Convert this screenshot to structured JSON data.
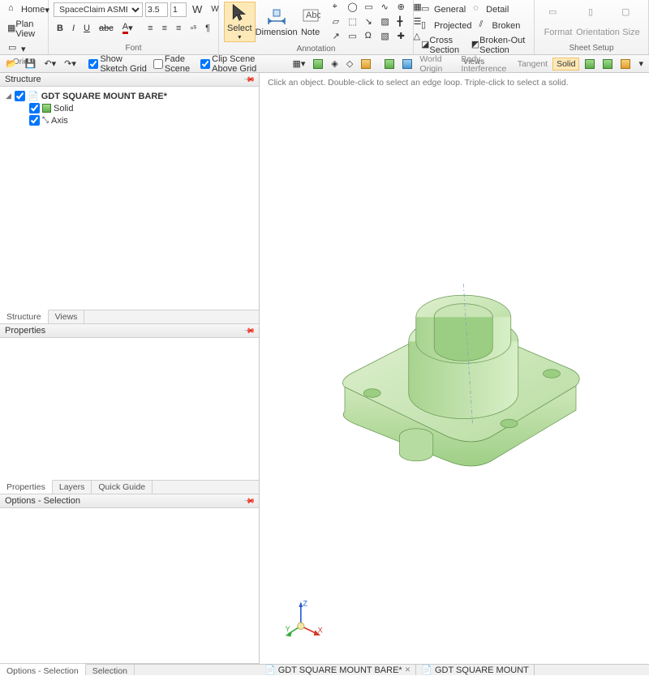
{
  "ribbon": {
    "orient": {
      "home": "Home",
      "planview": "Plan View",
      "label": "Orient"
    },
    "font": {
      "family_value": "SpaceClaim ASME C",
      "size_value": "3.5",
      "weight_value": "1",
      "label": "Font"
    },
    "annotation": {
      "select": "Select",
      "dimension": "Dimension",
      "note": "Note",
      "label": "Annotation"
    },
    "views": {
      "general": "General",
      "projected": "Projected",
      "cross_section": "Cross Section",
      "detail": "Detail",
      "broken": "Broken",
      "broken_out": "Broken-Out Section",
      "label": "Views"
    },
    "sheet": {
      "format": "Format",
      "orientation": "Orientation",
      "size": "Size",
      "label": "Sheet Setup"
    }
  },
  "toolbar2": {
    "show_sketch_grid": "Show Sketch Grid",
    "fade_scene": "Fade Scene",
    "clip_scene": "Clip Scene Above Grid",
    "world_origin": "World Origin",
    "body_interference": "Body Interference",
    "tangent": "Tangent",
    "solid": "Solid"
  },
  "panels": {
    "structure": {
      "title": "Structure",
      "root": "GDT SQUARE MOUNT BARE*",
      "children": [
        {
          "label": "Solid",
          "checked": true
        },
        {
          "label": "Axis",
          "checked": true
        }
      ],
      "tabs": [
        "Structure",
        "Views"
      ]
    },
    "properties": {
      "title": "Properties",
      "tabs": [
        "Properties",
        "Layers",
        "Quick Guide"
      ]
    },
    "options": {
      "title": "Options - Selection",
      "tabs": [
        "Options - Selection",
        "Selection"
      ]
    }
  },
  "viewport": {
    "hint": "Click an object. Double-click to select an edge loop. Triple-click to select a solid.",
    "axes": {
      "x": "X",
      "y": "Y",
      "z": "Z"
    }
  },
  "doctabs": [
    {
      "label": "GDT SQUARE MOUNT BARE*",
      "closable": true
    },
    {
      "label": "GDT SQUARE MOUNT",
      "closable": false
    }
  ]
}
